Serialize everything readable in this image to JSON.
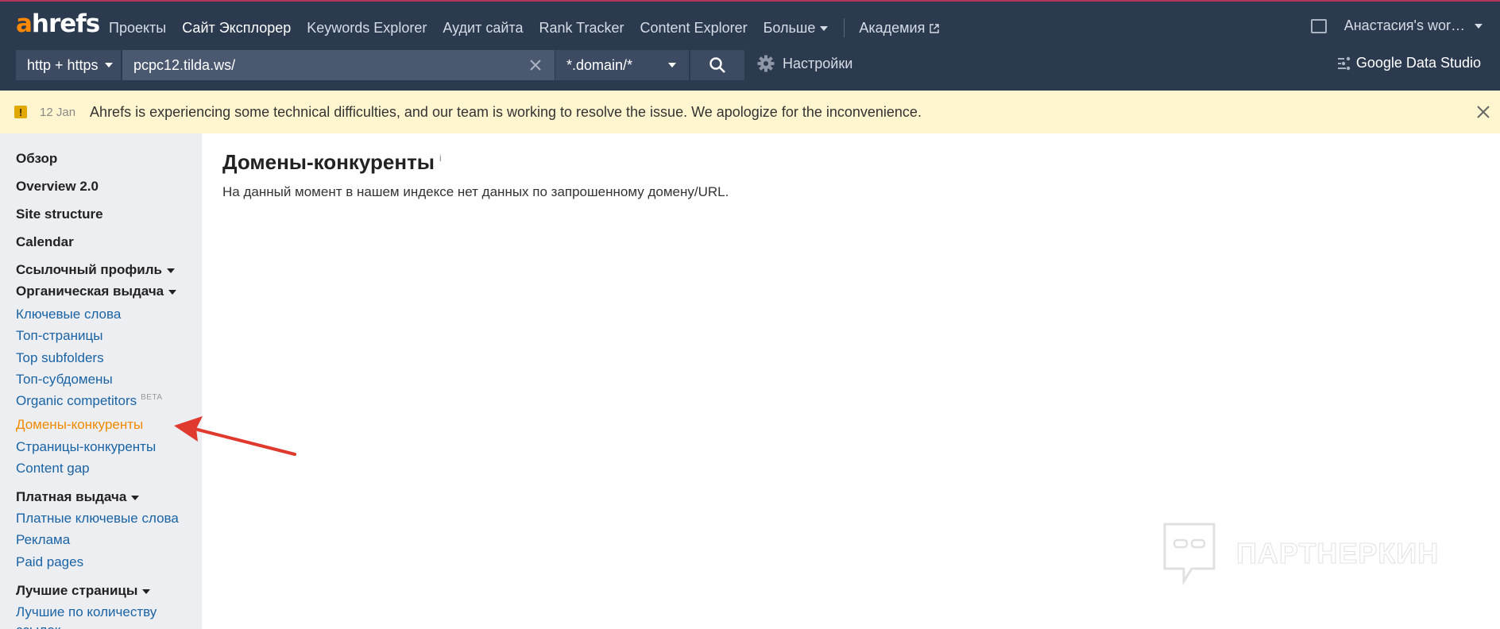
{
  "app": {
    "logo_a": "a",
    "logo_rest": "hrefs"
  },
  "nav": {
    "items": [
      {
        "label": "Проекты"
      },
      {
        "label": "Сайт Эксплорер"
      },
      {
        "label": "Keywords Explorer"
      },
      {
        "label": "Аудит сайта"
      },
      {
        "label": "Rank Tracker"
      },
      {
        "label": "Content Explorer"
      },
      {
        "label": "Больше"
      }
    ],
    "academy": "Академия",
    "user": "Анастасия's wor…"
  },
  "search": {
    "protocol": "http + https",
    "url": "pcpc12.tilda.ws/",
    "mode": "*.domain/*",
    "settings": "Настройки",
    "gds": "Google Data Studio"
  },
  "banner": {
    "icon": "!",
    "date": "12 Jan",
    "text": "Ahrefs is experiencing some technical difficulties, and our team is working to resolve the issue. We apologize for the inconvenience."
  },
  "sidebar": {
    "items": [
      {
        "label": "Обзор"
      },
      {
        "label": "Overview 2.0"
      },
      {
        "label": "Site structure"
      },
      {
        "label": "Calendar"
      },
      {
        "label": "Ссылочный профиль"
      },
      {
        "label": "Органическая выдача"
      },
      {
        "label": "Ключевые слова"
      },
      {
        "label": "Топ-страницы"
      },
      {
        "label": "Top subfolders"
      },
      {
        "label": "Топ-субдомены"
      },
      {
        "label": "Organic competitors",
        "badge": "BETA"
      },
      {
        "label": "Домены-конкуренты"
      },
      {
        "label": "Страницы-конкуренты"
      },
      {
        "label": "Content gap"
      },
      {
        "label": "Платная выдача"
      },
      {
        "label": "Платные ключевые слова"
      },
      {
        "label": "Реклама"
      },
      {
        "label": "Paid pages"
      },
      {
        "label": "Лучшие страницы"
      },
      {
        "label": "Лучшие по количеству"
      },
      {
        "label": "ссылок"
      }
    ]
  },
  "main": {
    "title": "Домены-конкуренты",
    "info": "i",
    "message": "На данный момент в нашем индексе нет данных по запрошенному домену/URL."
  },
  "watermark": {
    "text": "ПАРТНЕРКИН"
  },
  "colors": {
    "header_bg": "#2c3a50",
    "accent": "#ff8800",
    "link": "#1a63a5",
    "active": "#f08a00",
    "banner_bg": "#fff6d0",
    "arrow": "#e03a2f"
  }
}
